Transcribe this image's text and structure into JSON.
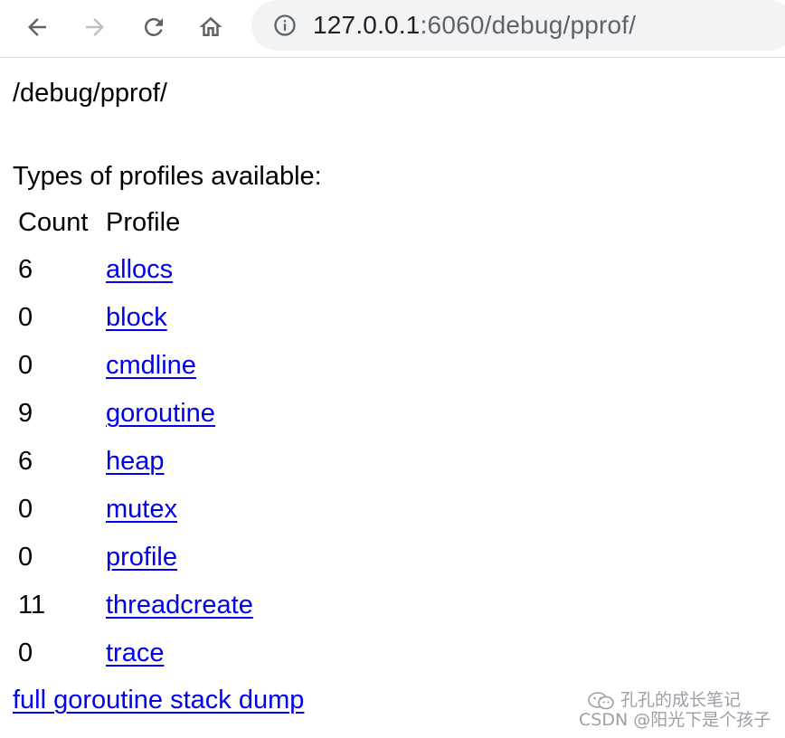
{
  "browser": {
    "url_host": "127.0.0.1",
    "url_path": ":6060/debug/pprof/",
    "back_icon": "arrow-left-icon",
    "forward_icon": "arrow-right-icon",
    "reload_icon": "reload-icon",
    "home_icon": "home-icon",
    "info_icon": "info-icon"
  },
  "page": {
    "title": "/debug/pprof/",
    "subtitle": "Types of profiles available:",
    "table": {
      "headers": {
        "count": "Count",
        "profile": "Profile"
      },
      "rows": [
        {
          "count": "6",
          "profile": "allocs"
        },
        {
          "count": "0",
          "profile": "block"
        },
        {
          "count": "0",
          "profile": "cmdline"
        },
        {
          "count": "9",
          "profile": "goroutine"
        },
        {
          "count": "6",
          "profile": "heap"
        },
        {
          "count": "0",
          "profile": "mutex"
        },
        {
          "count": "0",
          "profile": "profile"
        },
        {
          "count": "11",
          "profile": "threadcreate"
        },
        {
          "count": "0",
          "profile": "trace"
        }
      ]
    },
    "dump_link": "full goroutine stack dump"
  },
  "watermark": {
    "line1": "孔孔的成长笔记",
    "line2": "CSDN @阳光下是个孩子"
  },
  "colors": {
    "link": "#0000ee",
    "omnibox": "#f1f3f4",
    "icon": "#5f6368"
  }
}
